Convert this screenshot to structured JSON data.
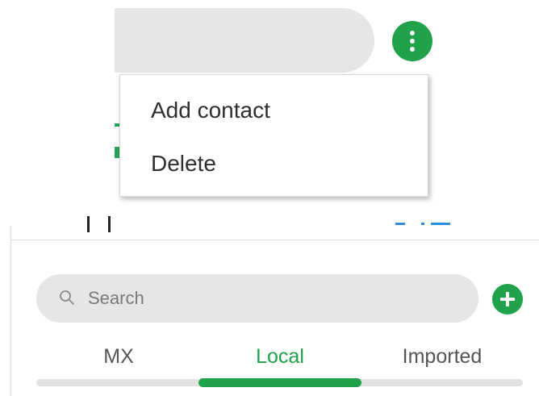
{
  "header": {
    "more_button_icon": "vertical-ellipsis-icon"
  },
  "context_menu": {
    "items": [
      {
        "label": "Add contact"
      },
      {
        "label": "Delete"
      }
    ]
  },
  "search": {
    "placeholder": "Search",
    "value": "",
    "icon": "search-icon"
  },
  "add_button": {
    "icon": "plus-icon"
  },
  "tabs": [
    {
      "label": "MX",
      "active": false
    },
    {
      "label": "Local",
      "active": true
    },
    {
      "label": "Imported",
      "active": false
    }
  ],
  "colors": {
    "accent": "#20a24a",
    "pill_background": "#e6e6e6",
    "tab_inactive": "#555555"
  }
}
